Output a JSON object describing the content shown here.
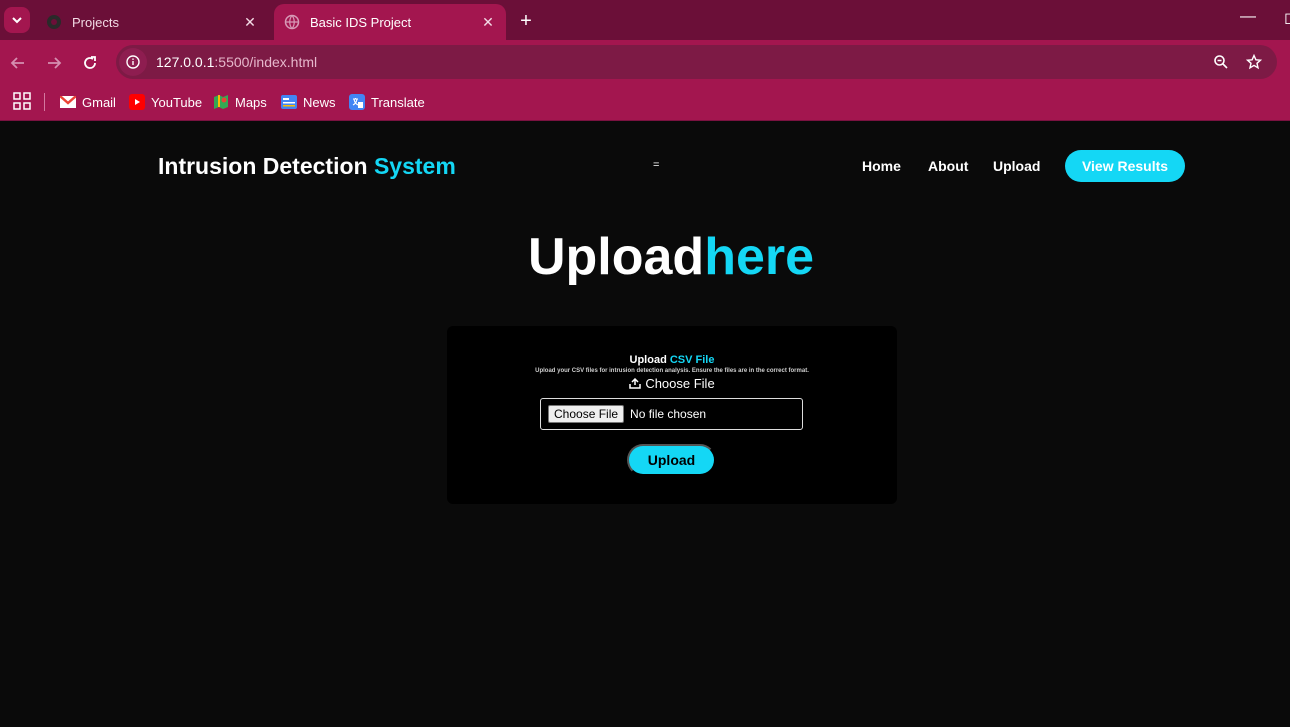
{
  "browser": {
    "tabs": [
      {
        "title": "Projects",
        "active": false
      },
      {
        "title": "Basic IDS Project",
        "active": true
      }
    ],
    "url_host": "127.0.0.1",
    "url_path": ":5500/index.html",
    "bookmarks": [
      {
        "label": "Gmail",
        "icon": "gmail-icon"
      },
      {
        "label": "YouTube",
        "icon": "youtube-icon"
      },
      {
        "label": "Maps",
        "icon": "maps-icon"
      },
      {
        "label": "News",
        "icon": "news-icon"
      },
      {
        "label": "Translate",
        "icon": "translate-icon"
      }
    ],
    "colors": {
      "tabstrip": "#6b0f38",
      "toolbar": "#a3164f",
      "accent": "#14d7f5"
    }
  },
  "header": {
    "brand_main": "Intrusion Detection",
    "brand_accent": "System",
    "hamburger": "=",
    "nav": [
      "Home",
      "About",
      "Upload"
    ],
    "cta": "View Results"
  },
  "hero": {
    "main": "Upload",
    "accent": "here"
  },
  "upload_card": {
    "title_main": "Upload",
    "title_accent": "CSV File",
    "description": "Upload your CSV files for intrusion detection analysis. Ensure the files are in the correct format.",
    "choose_label": "Choose File",
    "file_button": "Choose File",
    "file_status": "No file chosen",
    "submit": "Upload"
  }
}
